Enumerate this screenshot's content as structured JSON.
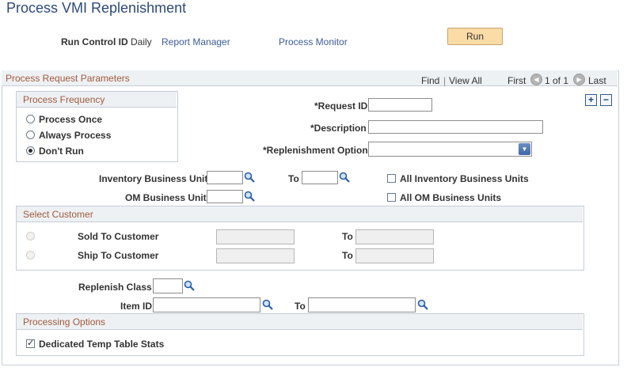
{
  "page": {
    "title": "Process VMI Replenishment"
  },
  "header": {
    "run_control_label": "Run Control ID",
    "run_control_value": "Daily",
    "report_manager": "Report Manager",
    "process_monitor": "Process Monitor",
    "run_label": "Run"
  },
  "panel": {
    "title": "Process Request Parameters",
    "find": "Find",
    "separator": "|",
    "view_all": "View All",
    "first": "First",
    "page_info": "1 of 1",
    "last": "Last",
    "add": "+",
    "remove": "−"
  },
  "frequency": {
    "title": "Process Frequency",
    "options": [
      "Process Once",
      "Always Process",
      "Don't Run"
    ],
    "selected": "Don't Run"
  },
  "request": {
    "request_id_label": "*Request ID",
    "request_id_value": "",
    "description_label": "*Description",
    "description_value": "",
    "replenishment_label": "*Replenishment Option",
    "replenishment_value": ""
  },
  "business_units": {
    "inv_label": "Inventory Business Unit",
    "to_label": "To",
    "all_inv_label": "All Inventory Business Units",
    "all_inv_checked": false,
    "om_label": "OM Business Unit",
    "all_om_label": "All OM Business Units",
    "all_om_checked": false
  },
  "customer": {
    "title": "Select Customer",
    "sold_to_label": "Sold To Customer",
    "ship_to_label": "Ship To Customer",
    "to_label": "To"
  },
  "replenish": {
    "class_label": "Replenish Class",
    "item_label": "Item ID",
    "to_label": "To"
  },
  "processing": {
    "title": "Processing Options",
    "dedicated_label": "Dedicated Temp Table Stats",
    "dedicated_checked": true
  },
  "icons": {
    "lookup": "magnifier-icon",
    "dropdown": "chevron-down-icon",
    "prev": "arrow-left-icon",
    "next": "arrow-right-icon"
  }
}
